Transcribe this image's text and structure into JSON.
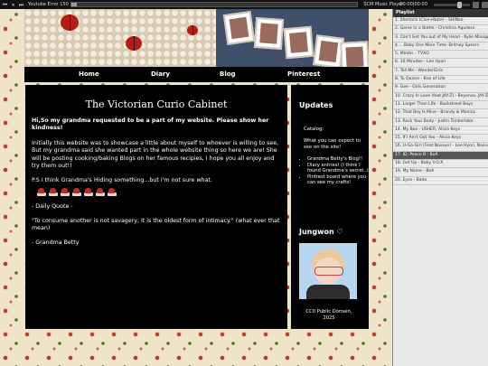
{
  "player": {
    "track": "Youtube Error 150",
    "name": "SCM Music Player",
    "time": "00:00|00:00",
    "progress": 0.02,
    "volume": 0.7
  },
  "playlist": {
    "header": "Playlist",
    "items": [
      "1. Sherlock (Clue+Note) - SHINee",
      "2. Genie In a Bottle - Christina Aguilera",
      "3. Can't Get You out of My Head - Kylie Minogue",
      "4. ...Baby One More Time -Britney Spears",
      "5. Mirotic - TVXQ",
      "6. 10 Minutes - Lee Hyori",
      "7. Tell Me - WonderGirls",
      "8. Tu Quiero - Kiss of Life",
      "9. Gee - Girls Generation",
      "10. Crazy In Love (feat.JAY-Z) - Beyonce, JAY-Z",
      "11. Larger Than Life - Backstreet Boys",
      "12. That Boy Is Mine - Brandy & Monica",
      "13. Rock Your Body - Justin Timberlake",
      "14. My Boo - USHER, Alicia Keys",
      "15. If I Ain't Got You - Alicia Keys",
      "16. U-Go-Girl (Feat Nassun) - Lee Hyori, Nassun",
      "17. ID; Peace B - BoA",
      "18. Get Up - Baby V.O.X",
      "19. My Name - BoA",
      "20. Eyes - Bada"
    ],
    "active_index": 16
  },
  "nav": {
    "home": "Home",
    "diary": "Diary",
    "blog": "Blog",
    "pinterest": "Pinterest"
  },
  "main": {
    "title": "The Victorian Curio Cabinet",
    "intro": "Hi,So my grandma requested to be a part of my website. Please show her kindness!",
    "para1": "Initially this website was to showcase a little about myself to whoever is willing to see, But my grandma said she wanted part in the whole website thing so here we are! She will be posting cooking/baking Blogs on her famous recipies, I hope you all enjoy and try them out!!",
    "para2": "P.S I think Grandma's Hiding something...but i'm not sure what.",
    "quote_label": "- Daily Quote -",
    "quote": "\"To consume another is not savagery, it is the oldest form of intimacy.\" (what ever that mean)",
    "signature": "- Grandma Betty"
  },
  "side": {
    "updates_title": "Updates",
    "catalog": "Catalog:",
    "expect": "What you can expect to see on the site!",
    "items": [
      "Grandma Betty's Blog!!",
      "Diary entries! (I think I found Grandma's secret..)",
      "Pintrest board where you can see my crafts!"
    ],
    "profile_name": "Jungwon ♡",
    "credit": "CC0 Public Domain, 2025"
  },
  "colors": {
    "accent": "#b51d14",
    "panel": "#000000",
    "wallpaper": "#efe3c8"
  }
}
